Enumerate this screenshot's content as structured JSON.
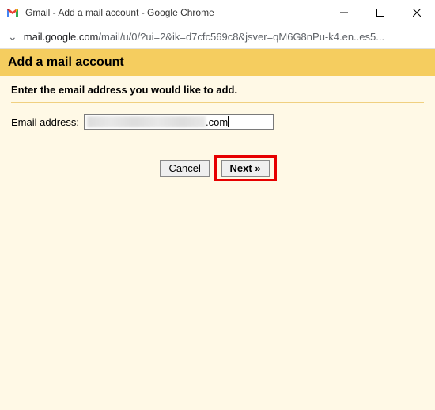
{
  "window": {
    "title": "Gmail - Add a mail account - Google Chrome"
  },
  "addressbar": {
    "domain": "mail.google.com",
    "path": "/mail/u/0/?ui=2&ik=d7cfc569c8&jsver=qM6G8nPu-k4.en..es5..."
  },
  "page": {
    "title": "Add a mail account",
    "instruction": "Enter the email address you would like to add.",
    "field_label": "Email address:",
    "email_visible_suffix": ".com",
    "cancel_label": "Cancel",
    "next_label": "Next »"
  }
}
